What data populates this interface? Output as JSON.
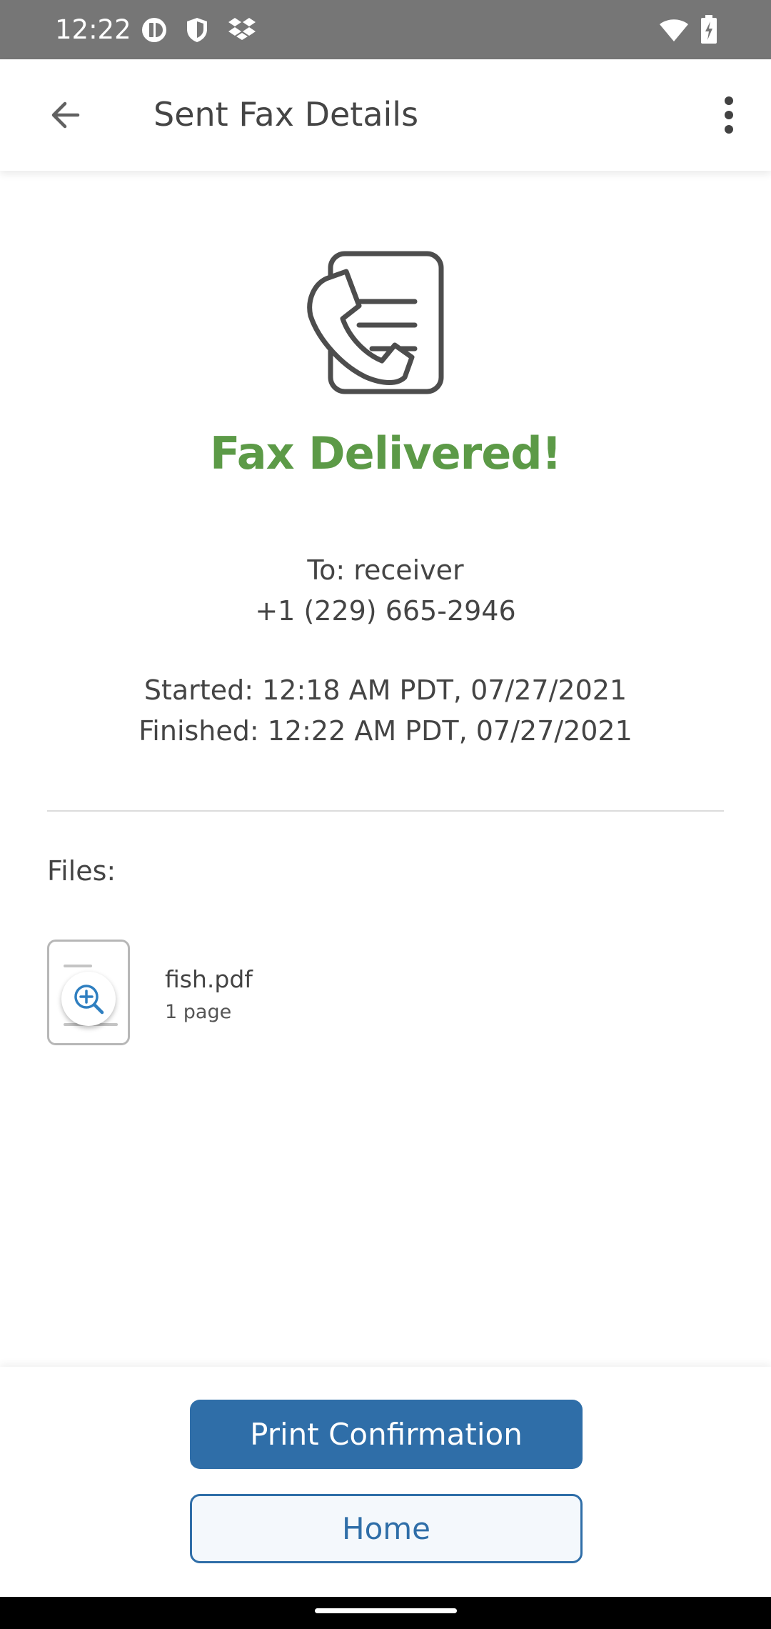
{
  "status_bar": {
    "time": "12:22",
    "left_icons": [
      "data-saver-icon",
      "shield-icon",
      "dropbox-icon"
    ],
    "right_icons": [
      "wifi-icon",
      "battery-charging-icon"
    ]
  },
  "app_bar": {
    "title": "Sent Fax Details",
    "back_icon": "arrow-back-icon",
    "menu_icon": "more-vert-icon"
  },
  "fax": {
    "illustration_icon": "fax-document-icon",
    "status": "Fax Delivered!",
    "status_color": "#5c9a47",
    "to_line": "To: receiver",
    "phone": "+1 (229) 665-2946",
    "started": "Started: 12:18 AM PDT, 07/27/2021",
    "finished": "Finished: 12:22 AM PDT, 07/27/2021"
  },
  "files": {
    "label": "Files:",
    "items": [
      {
        "name": "fish.pdf",
        "pages": "1 page",
        "preview_icon": "zoom-in-icon"
      }
    ]
  },
  "actions": {
    "primary_label": "Print Confirmation",
    "secondary_label": "Home",
    "accent_color": "#2f6ea8"
  }
}
